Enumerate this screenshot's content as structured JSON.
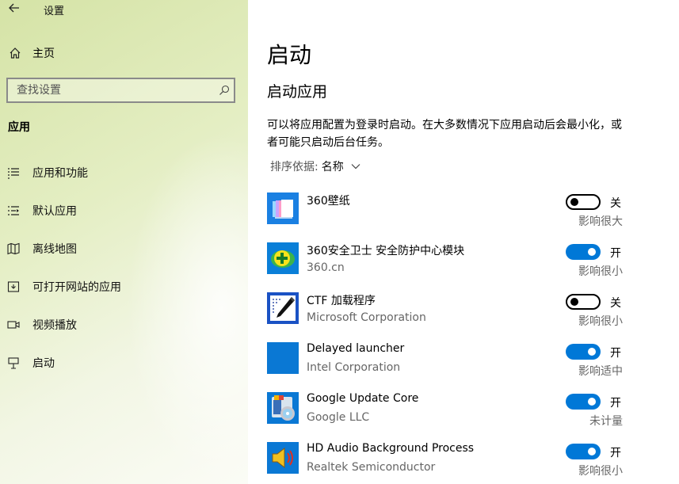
{
  "window": {
    "title": "设置"
  },
  "sidebar": {
    "home_label": "主页",
    "search_placeholder": "查找设置",
    "section_label": "应用",
    "items": [
      {
        "label": "应用和功能",
        "icon": "list-icon"
      },
      {
        "label": "默认应用",
        "icon": "default-apps-icon"
      },
      {
        "label": "离线地图",
        "icon": "map-icon"
      },
      {
        "label": "可打开网站的应用",
        "icon": "web-app-icon"
      },
      {
        "label": "视频播放",
        "icon": "video-icon"
      },
      {
        "label": "启动",
        "icon": "startup-icon"
      }
    ]
  },
  "main": {
    "title": "启动",
    "subtitle": "启动应用",
    "description": "可以将应用配置为登录时启动。在大多数情况下应用启动后会最小化，或者可能只启动后台任务。",
    "sort_label": "排序依据:",
    "sort_value": "名称",
    "apps": [
      {
        "name": "360壁纸",
        "publisher": "",
        "enabled": false,
        "state_label": "关",
        "impact": "影响很大",
        "icon": "360-wallpaper-icon"
      },
      {
        "name": "360安全卫士 安全防护中心模块",
        "publisher": "360.cn",
        "enabled": true,
        "state_label": "开",
        "impact": "影响很小",
        "icon": "360-safe-icon"
      },
      {
        "name": "CTF 加载程序",
        "publisher": "Microsoft Corporation",
        "enabled": false,
        "state_label": "关",
        "impact": "影响很小",
        "icon": "ctf-loader-icon"
      },
      {
        "name": "Delayed launcher",
        "publisher": "Intel Corporation",
        "enabled": true,
        "state_label": "开",
        "impact": "影响适中",
        "icon": "delayed-launcher-icon"
      },
      {
        "name": "Google Update Core",
        "publisher": "Google LLC",
        "enabled": true,
        "state_label": "开",
        "impact": "未计量",
        "icon": "google-update-icon"
      },
      {
        "name": "HD Audio Background Process",
        "publisher": "Realtek Semiconductor",
        "enabled": true,
        "state_label": "开",
        "impact": "影响很小",
        "icon": "speaker-icon"
      }
    ]
  },
  "colors": {
    "accent": "#0078d7",
    "sidebar_tint": "#dce8b0"
  }
}
